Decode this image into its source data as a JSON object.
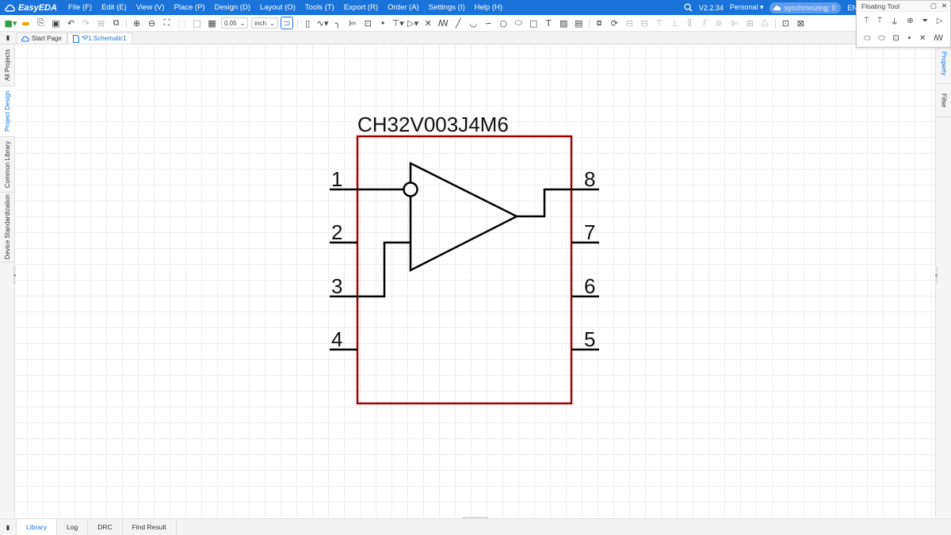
{
  "app": {
    "name": "EasyEDA",
    "version": "V2.2.34",
    "edition": "Personal",
    "sync_status": "synchronizing: 0",
    "language": "EN",
    "accent_color": "#1a73d9"
  },
  "menu": [
    "File (F)",
    "Edit (E)",
    "View (V)",
    "Place (P)",
    "Design (D)",
    "Layout (O)",
    "Tools (T)",
    "Export (R)",
    "Order (A)",
    "Settings (I)",
    "Help (H)"
  ],
  "toolbar": {
    "grid_value": "0.05",
    "unit": "inch"
  },
  "floating_tool": {
    "title": "Floating Tool"
  },
  "tabs": [
    {
      "label": "Start Page",
      "icon": "cloud-icon"
    },
    {
      "label": "*P1.Schematic1",
      "icon": "document-icon"
    }
  ],
  "left_panels": [
    "All Projects",
    "Project Design",
    "Common Library",
    "Device Standardization"
  ],
  "right_panels": [
    "Property",
    "Filter"
  ],
  "bottom_tabs": [
    "Library",
    "Log",
    "DRC",
    "Find Result"
  ],
  "schematic": {
    "part_name": "CH32V003J4M6",
    "body_color": "#a50000",
    "pins_left": [
      "1",
      "2",
      "3",
      "4"
    ],
    "pins_right": [
      "8",
      "7",
      "6",
      "5"
    ]
  }
}
